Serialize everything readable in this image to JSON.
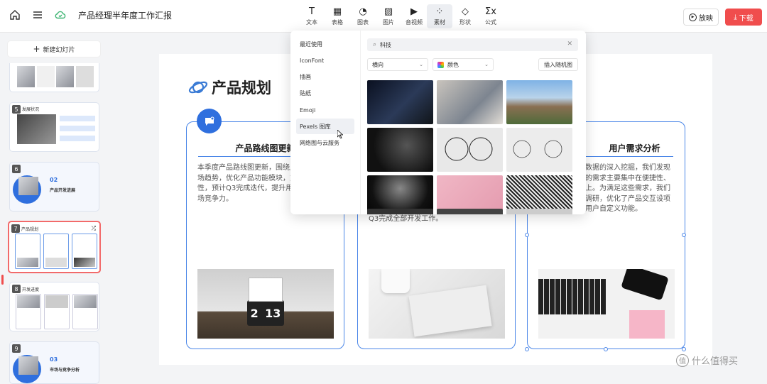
{
  "header": {
    "doc_title": "产品经理半年度工作汇报",
    "tools": [
      {
        "icon": "T",
        "label": "文本"
      },
      {
        "icon": "▦",
        "label": "表格"
      },
      {
        "icon": "◔",
        "label": "图表"
      },
      {
        "icon": "▨",
        "label": "图片"
      },
      {
        "icon": "▶",
        "label": "音视频"
      },
      {
        "icon": "⁘",
        "label": "素材"
      },
      {
        "icon": "◇",
        "label": "形状"
      },
      {
        "icon": "Σx",
        "label": "公式"
      }
    ],
    "play_label": "放映",
    "download_label": "下载"
  },
  "sidebar": {
    "new_slide_label": "新建幻灯片",
    "slides": [
      {
        "num": "",
        "title": ""
      },
      {
        "num": "5",
        "title": "发展状况"
      },
      {
        "num": "6",
        "section": "02",
        "title": "产品开发进展"
      },
      {
        "num": "7",
        "title": "产品规划"
      },
      {
        "num": "8",
        "title": "开发进度"
      },
      {
        "num": "9",
        "section": "03",
        "title": "市场与竞争分析"
      }
    ]
  },
  "slide": {
    "title": "产品规划",
    "cards": [
      {
        "heading": "产品路线图更新",
        "text": "本季度产品路线图更新，围绕用户需求与市场趋势，优化产品功能模块，重点提升稳定性，预计Q3完成迭代，提升用户体验与市场竞争力。"
      },
      {
        "heading": "",
        "text": "Q3完成全部开发工作。"
      },
      {
        "heading": "用户需求分析",
        "text": "数据的深入挖掘，我们发现的需求主要集中在便捷性、上。为满足这些需求，我们调研，优化了产品交互设项用户自定义功能。"
      }
    ],
    "clock_digits": [
      "2",
      "13"
    ]
  },
  "popup": {
    "menu": [
      "最近使用",
      "IconFont",
      "插画",
      "贴纸",
      "Emoji",
      "Pexels 图库",
      "网络图与云服务"
    ],
    "active_index": 5,
    "search_value": "科技",
    "orientation": "横向",
    "color_label": "颜色",
    "random_button": "插入随机图"
  },
  "watermark": "什么值得买"
}
